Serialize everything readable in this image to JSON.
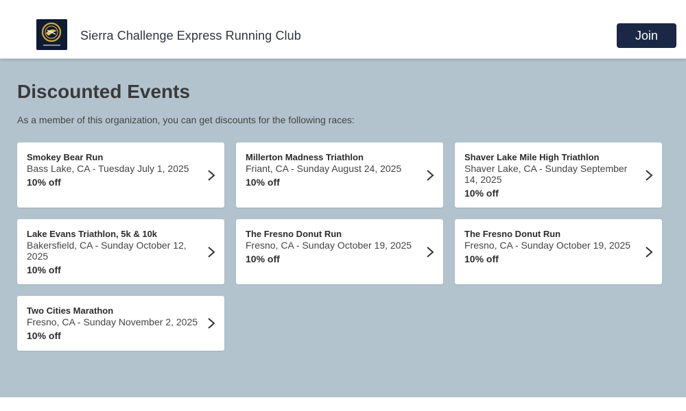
{
  "header": {
    "club_name": "Sierra Challenge Express Running Club",
    "logo_icon": "club-logo",
    "join_label": "Join"
  },
  "main": {
    "title": "Discounted Events",
    "intro": "As a member of this organization, you can get discounts for the following races:"
  },
  "events": [
    {
      "name": "Smokey Bear Run",
      "location": "Bass Lake, CA - Tuesday July 1, 2025",
      "discount": "10% off"
    },
    {
      "name": "Millerton Madness Triathlon",
      "location": "Friant, CA - Sunday August 24, 2025",
      "discount": "10% off"
    },
    {
      "name": "Shaver Lake Mile High Triathlon",
      "location": "Shaver Lake, CA - Sunday September 14, 2025",
      "discount": "10% off"
    },
    {
      "name": "Lake Evans Triathlon, 5k & 10k",
      "location": "Bakersfield, CA - Sunday October 12, 2025",
      "discount": "10% off"
    },
    {
      "name": "The Fresno Donut Run",
      "location": "Fresno, CA - Sunday October 19, 2025",
      "discount": "10% off"
    },
    {
      "name": "The Fresno Donut Run",
      "location": "Fresno, CA - Sunday October 19, 2025",
      "discount": "10% off"
    },
    {
      "name": "Two Cities Marathon",
      "location": "Fresno, CA - Sunday November 2, 2025",
      "discount": "10% off"
    }
  ],
  "colors": {
    "header_bg": "#ffffff",
    "main_bg": "#b2c3cd",
    "join_bg": "#1b2845",
    "card_bg": "#ffffff"
  }
}
